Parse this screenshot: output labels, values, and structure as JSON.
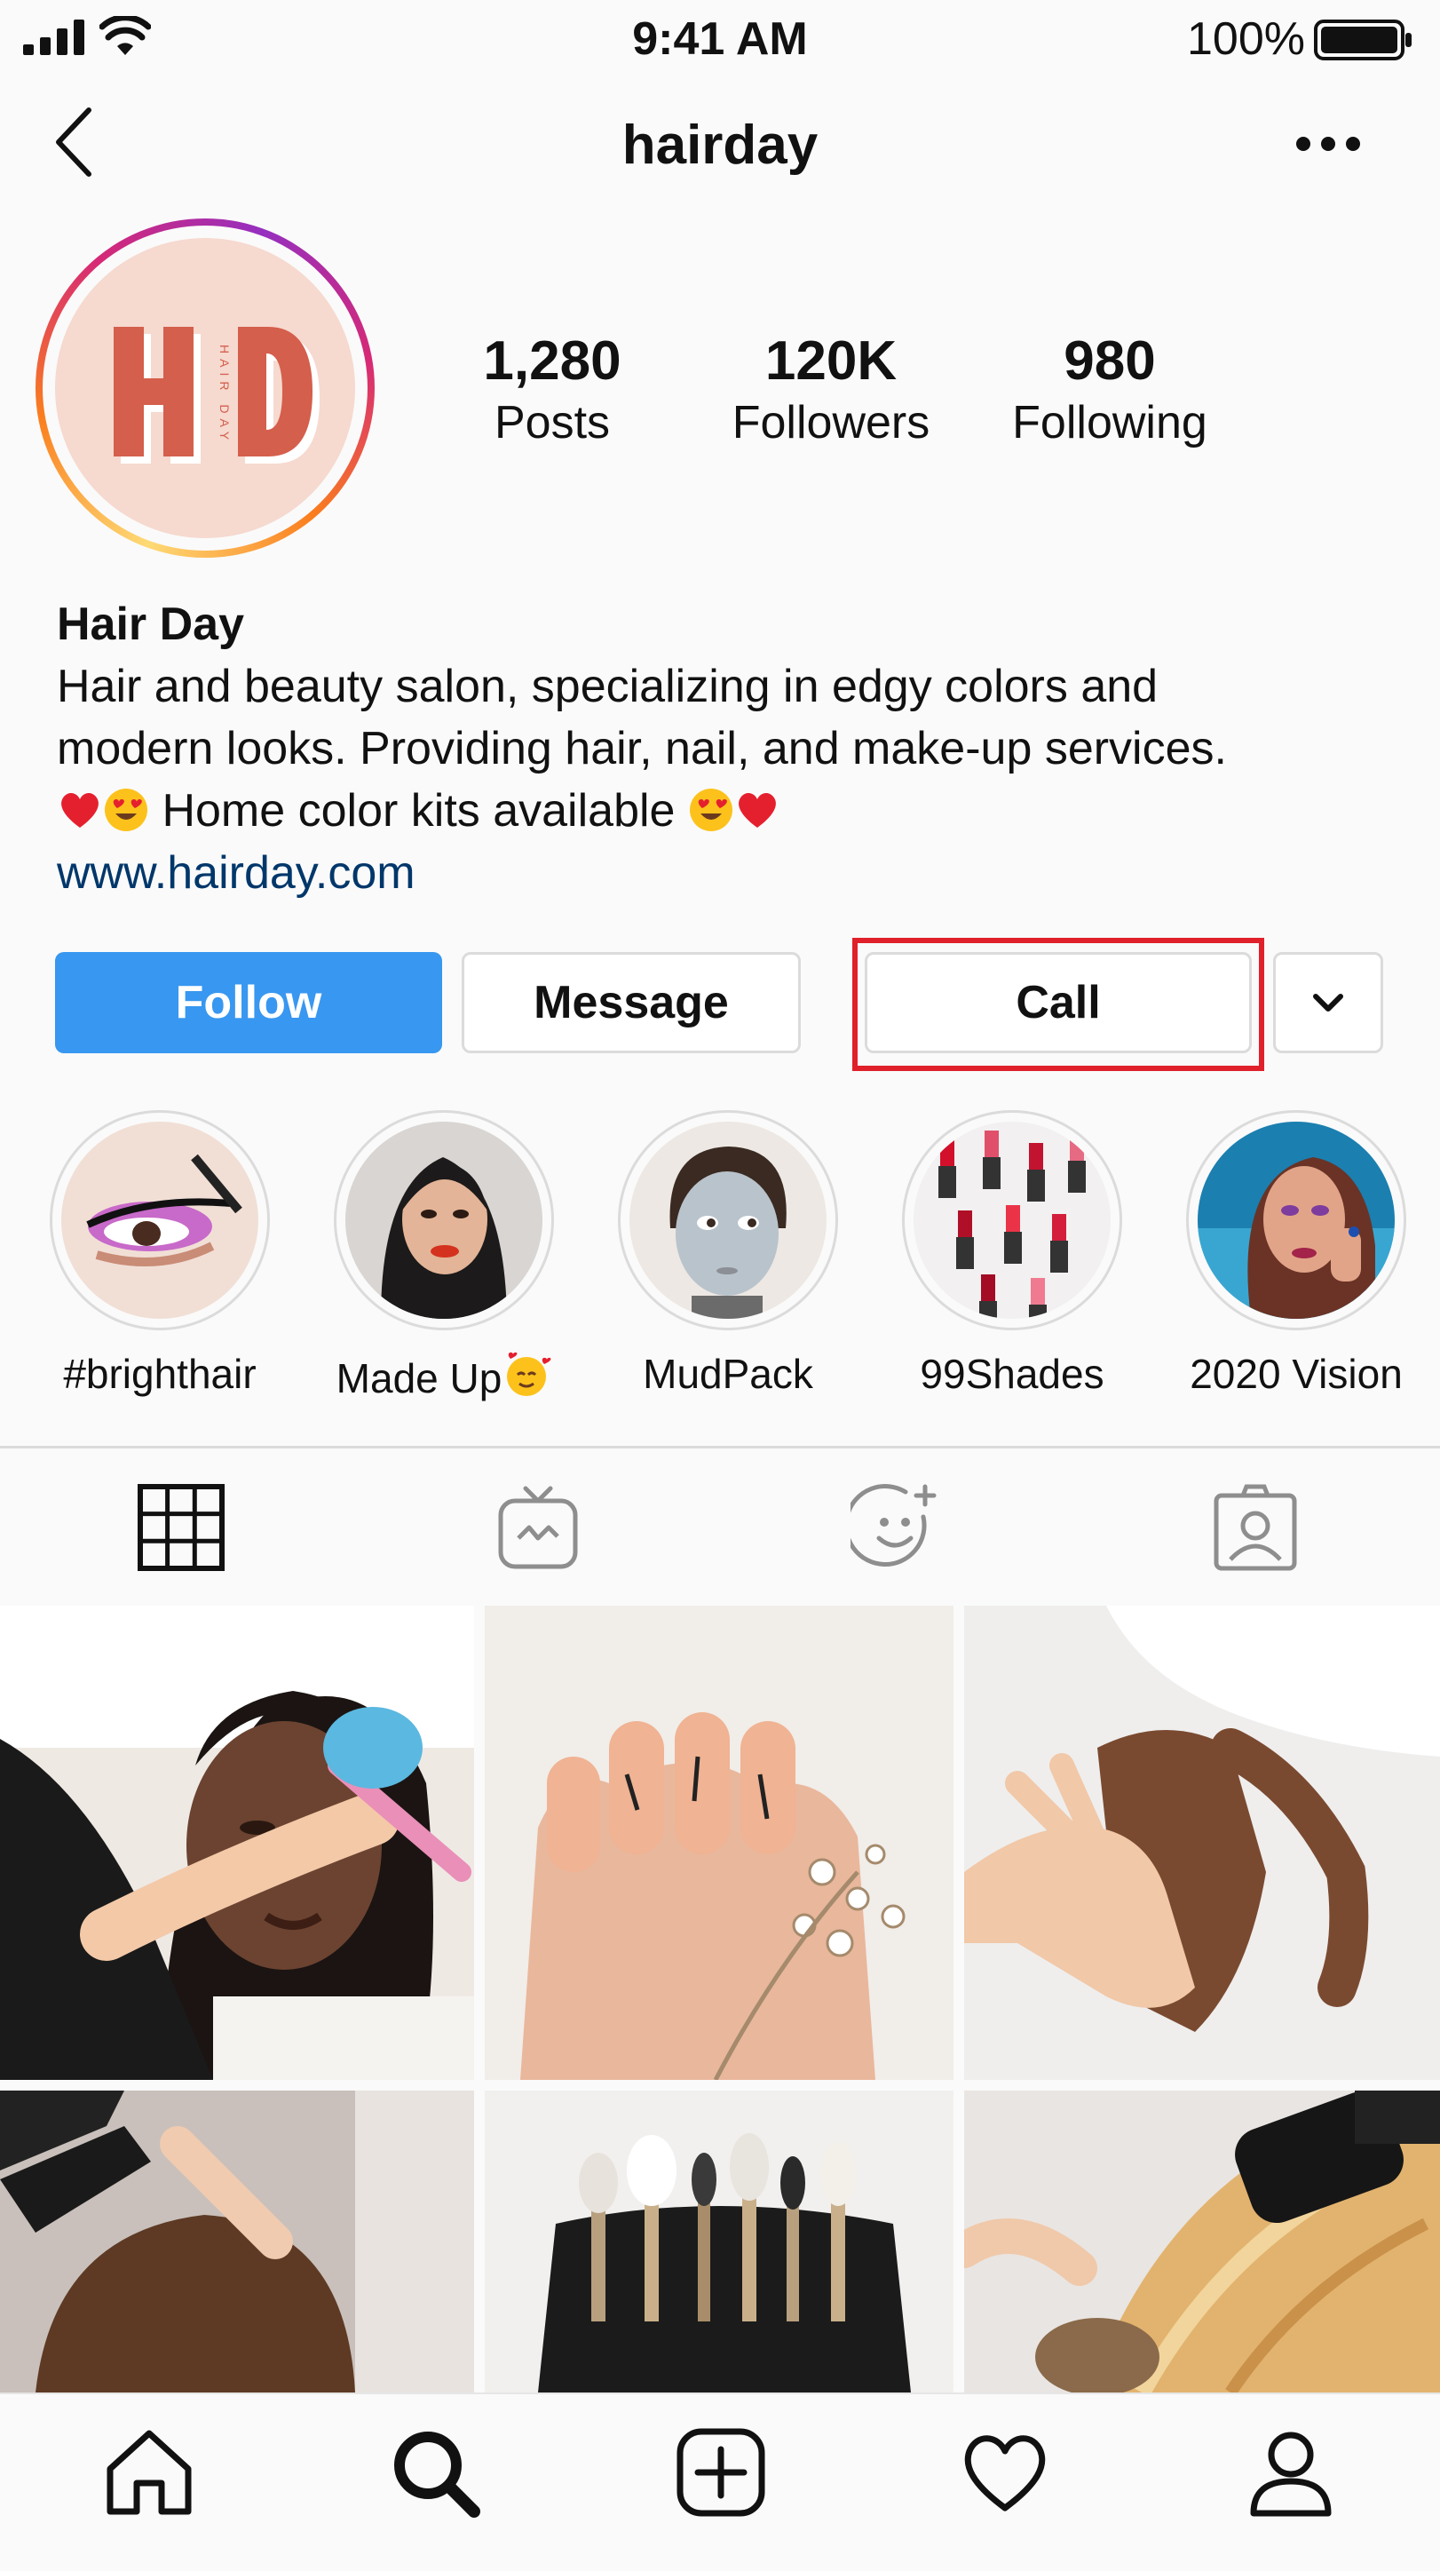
{
  "status_bar": {
    "time": "9:41 AM",
    "battery_percent": "100%"
  },
  "nav": {
    "title": "hairday",
    "back_icon": "chevron-left-icon",
    "more_icon": "more-horizontal-icon"
  },
  "profile": {
    "avatar_text": "HD",
    "avatar_sub": "HAIR DAY",
    "stats": {
      "posts_value": "1,280",
      "posts_label": "Posts",
      "followers_value": "120K",
      "followers_label": "Followers",
      "following_value": "980",
      "following_label": "Following"
    },
    "bio": {
      "name": "Hair Day",
      "line1": "Hair and beauty salon, specializing in edgy colors and",
      "line2": "modern looks. Providing hair, nail, and make-up services.",
      "line3": "Home color kits available",
      "link": "www.hairday.com"
    }
  },
  "actions": {
    "follow": "Follow",
    "message": "Message",
    "call": "Call",
    "more_icon": "chevron-down-icon"
  },
  "highlights": [
    {
      "label": "#brighthair"
    },
    {
      "label": "Made Up"
    },
    {
      "label": "MudPack"
    },
    {
      "label": "99Shades"
    },
    {
      "label": "2020 Vision"
    }
  ],
  "tabs": [
    "grid-icon",
    "igtv-icon",
    "smiley-icon",
    "tagged-icon"
  ],
  "bottom_nav": [
    "home-icon",
    "search-icon",
    "add-icon",
    "heart-icon",
    "profile-icon"
  ],
  "colors": {
    "follow_blue": "#3897f0",
    "highlight_red": "#e0202a",
    "link_blue": "#00376b"
  }
}
